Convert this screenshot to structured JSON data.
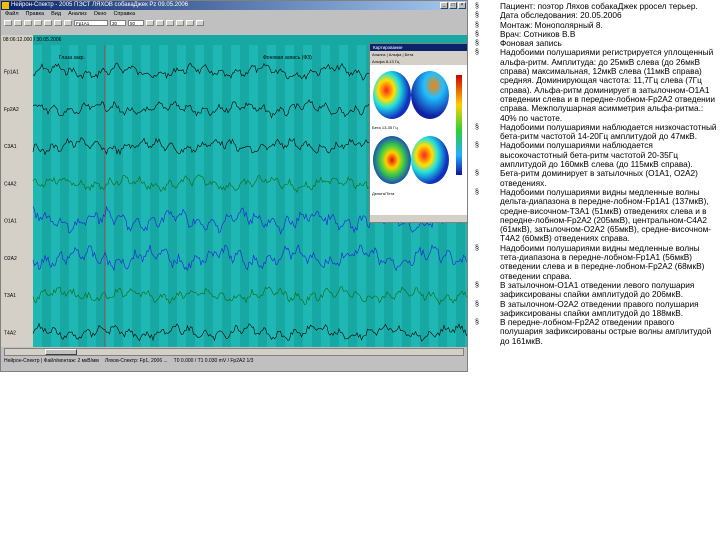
{
  "window": {
    "title": "Нейрон-Спектр - 2005 ПЭСТ ЛЯХОВ собакаДжек Pz 09.05.2006"
  },
  "menu": [
    "Файл",
    "Правка",
    "Вид",
    "Анализ",
    "Окно",
    "Справка"
  ],
  "toolbar": {
    "montage_value": "Fp1A1",
    "speed_value": "30",
    "amp_value": "50"
  },
  "eeg": {
    "timestamp": "08:06:12.000 / 30.05.2006",
    "annotation_left": "Глаза закр.",
    "annotation_right": "Фоновая запись (ФЗ)",
    "channels": [
      "Fp1A1",
      "Fp2A2",
      "C3A1",
      "C4A2",
      "O1A1",
      "O2A2",
      "T3A1",
      "T4A2"
    ]
  },
  "status": {
    "left": "Нейрон-Спектр | Файл/монтаж: 2 мкВ/мм",
    "mid": "Ляхов-Спектр: Fp1, 2006 ...",
    "right": "Т0 0.000 / Т1 0.030 mV / Fp2A2 1/3"
  },
  "mapwin": {
    "title": "Картирование",
    "toolbar": "Анализ | Альфа | Бета",
    "label_1": "Альфа  8-13 Гц",
    "label_2": "Бета  13-35 Гц",
    "label_3": "Дельта/Тета"
  },
  "colors": {
    "eeg_bg": "#17a8a4",
    "eeg_band": "#1fb7b3",
    "trace_black": "#000000",
    "trace_blue": "#1f1fd8",
    "trace_green": "#0d6b0d",
    "marker_red": "#d01010"
  },
  "findings": [
    "Пациент: поэтор Ляхов собакаДжек рросел терьер.",
    "Дата обследования: 20.05.2006",
    "Монтаж: Монополярный 8.",
    "Врач: Сотников В.В",
    "Фоновая запись",
    "Надобоими полушариями регистрируется уплощенный альфа-ритм. Амплитуда: до 25мкВ слева (до 26мкВ справа) максимальная, 12мкВ слева (11мкВ справа) средняя. Доминирующая частота: 11,7Гц слева (7Гц справа). Альфа-ритм доминирует в затылочном-О1А1 отведении слева и в передне-лобном-Fp2А2 отведении справа. Межполушарная асимметрия альфа-ритма.: 40% по частоте.",
    "Надобоими полушариями наблюдается низкочастотный бета-ритм частотой 14-20Гц амплитудой до 47мкВ.",
    "Надобоими полушариями наблюдается высокочастотный бета-ритм частотой 20-35Гц амплитудой до 160мкВ слева (до 115мкВ справа).",
    "Бета-ритм доминирует в затылочных (О1А1, О2А2) отведениях.",
    "Надобоими полушариями видны медленные волны дельта-диапазона в передне-лобном-Fp1A1 (137мкВ), средне-височном-Т3А1 (51мкВ) отведениях слева и в передне-лобном-Fp2A2 (205мкВ), центральном-С4А2 (61мкВ), затылочном-О2А2 (65мкВ), средне-височном-Т4А2 (60мкВ) отведениях справа.",
    "Надобоими полушариями видны медленные волны тета-диапазона в передне-лобном-Fp1A1 (56мкВ) отведении слева и в передне-лобном-Fp2A2 (68мкВ) отведении справа.",
    "В затылочном-О1А1 отведении левого полушария зафиксированы спайки амплитудой до 206мкВ.",
    "В затылочном-О2А2 отведении правого полушария зафиксированы спайки амплитудой до 188мкВ.",
    "В передне-лобном-Fp2A2 отведении правого полушария зафиксированы острые волны амплитудой до 161мкВ."
  ]
}
